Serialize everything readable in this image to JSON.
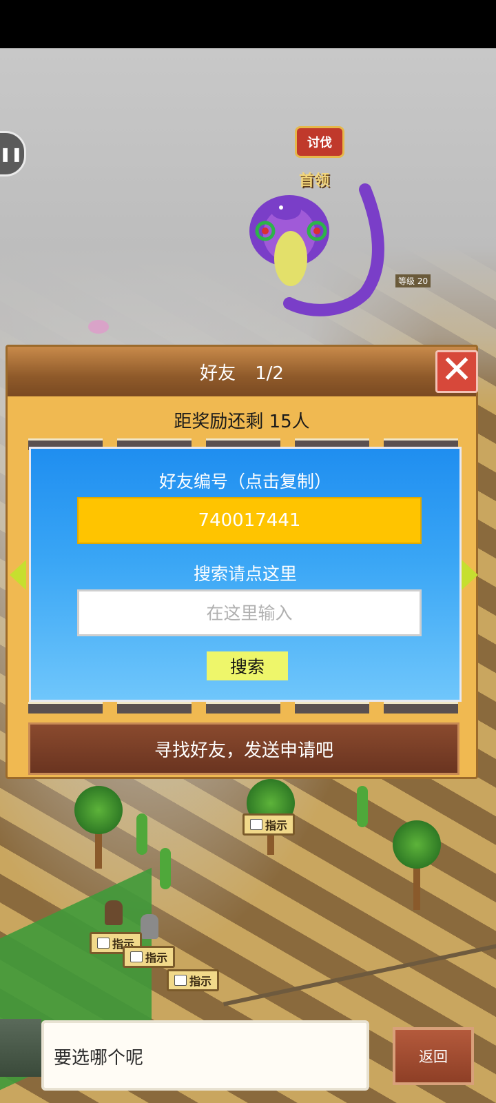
{
  "map": {
    "battle_badge": "讨伐",
    "boss_label": "首领",
    "level_label": "等级",
    "level_value": "20",
    "hint_label": "指示"
  },
  "friend_panel": {
    "title": "好友",
    "page": "1/2",
    "reward_remaining": "距奖励还剩 15人",
    "friend_id_label": "好友编号（点击复制）",
    "friend_id": "740017441",
    "search_label": "搜索请点这里",
    "search_placeholder": "在这里输入",
    "search_button": "搜索",
    "find_banner": "寻找好友，发送申请吧"
  },
  "dialog": {
    "text": "要选哪个呢",
    "back_button": "返回"
  },
  "colors": {
    "panel_bg": "#f0b951",
    "blue_panel": "#1f8ef0",
    "id_box": "#ffc400",
    "search_button": "#eef66a",
    "close_button": "#d7483a"
  }
}
